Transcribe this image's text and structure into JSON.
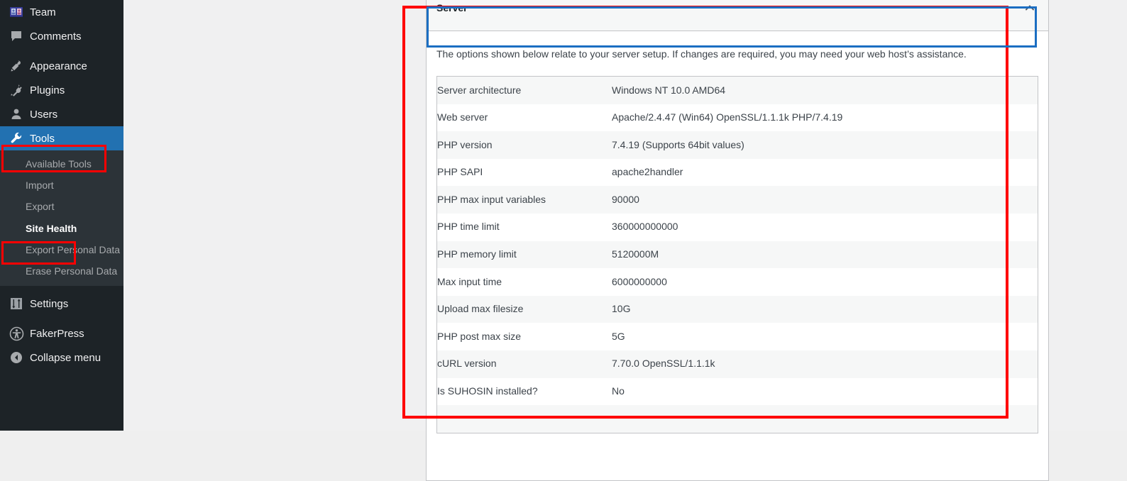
{
  "sidebar": {
    "items": [
      {
        "label": "Team",
        "icon": "team-icon",
        "type": "top",
        "current": false
      },
      {
        "label": "Comments",
        "icon": "comments-icon",
        "type": "top",
        "current": false
      },
      {
        "label": "Appearance",
        "icon": "appearance-brush-icon",
        "type": "top",
        "current": false
      },
      {
        "label": "Plugins",
        "icon": "plugins-plug-icon",
        "type": "top",
        "current": false
      },
      {
        "label": "Users",
        "icon": "users-person-icon",
        "type": "top",
        "current": false
      },
      {
        "label": "Tools",
        "icon": "tools-wrench-icon",
        "type": "top",
        "current": true
      },
      {
        "label": "Settings",
        "icon": "settings-sliders-icon",
        "type": "top",
        "current": false
      },
      {
        "label": "FakerPress",
        "icon": "fakerpress-icon",
        "type": "top",
        "current": false
      },
      {
        "label": "Collapse menu",
        "icon": "collapse-arrow-icon",
        "type": "top",
        "current": false
      }
    ],
    "submenu": [
      {
        "label": "Available Tools",
        "current": false
      },
      {
        "label": "Import",
        "current": false
      },
      {
        "label": "Export",
        "current": false
      },
      {
        "label": "Site Health",
        "current": true
      },
      {
        "label": "Export Personal Data",
        "current": false
      },
      {
        "label": "Erase Personal Data",
        "current": false
      }
    ]
  },
  "panel": {
    "title": "Server",
    "toggle_icon": "chevron-up-icon",
    "description": "The options shown below relate to your server setup. If changes are required, you may need your web host’s assistance.",
    "rows": [
      {
        "key": "Server architecture",
        "value": "Windows NT 10.0 AMD64"
      },
      {
        "key": "Web server",
        "value": "Apache/2.4.47 (Win64) OpenSSL/1.1.1k PHP/7.4.19"
      },
      {
        "key": "PHP version",
        "value": "7.4.19 (Supports 64bit values)"
      },
      {
        "key": "PHP SAPI",
        "value": "apache2handler"
      },
      {
        "key": "PHP max input variables",
        "value": "90000"
      },
      {
        "key": "PHP time limit",
        "value": "360000000000"
      },
      {
        "key": "PHP memory limit",
        "value": "5120000M"
      },
      {
        "key": "Max input time",
        "value": "6000000000"
      },
      {
        "key": "Upload max filesize",
        "value": "10G"
      },
      {
        "key": "PHP post max size",
        "value": "5G"
      },
      {
        "key": "cURL version",
        "value": "7.70.0 OpenSSL/1.1.1k"
      },
      {
        "key": "Is SUHOSIN installed?",
        "value": "No"
      }
    ]
  },
  "annotations": {
    "highlight_color": "#ff0000",
    "focus_color": "#1b6ec2",
    "targets": [
      "tools-menu-item",
      "site-health-submenu-item",
      "server-panel",
      "server-panel-header"
    ]
  },
  "colors": {
    "menu_bg": "#1d2327",
    "submenu_bg": "#2c3338",
    "accent": "#2271b1",
    "content_bg": "#f0f0f1",
    "row_alt": "#f6f7f7"
  }
}
